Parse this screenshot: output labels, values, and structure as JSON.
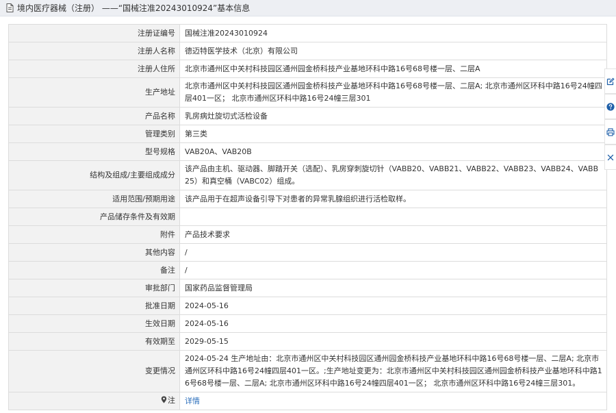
{
  "header": {
    "icon": "document-icon",
    "title": "境内医疗器械（注册） ——“国械注准20243010924”基本信息"
  },
  "rows": [
    {
      "label": "注册证编号",
      "value": "国械注准20243010924"
    },
    {
      "label": "注册人名称",
      "value": "德迈特医学技术（北京）有限公司"
    },
    {
      "label": "注册人住所",
      "value": "北京市通州区中关村科技园区通州园金桥科技产业基地环科中路16号68号楼一层、二层A"
    },
    {
      "label": "生产地址",
      "value": "北京市通州区中关村科技园区通州园金桥科技产业基地环科中路16号68号楼一层、二层A; 北京市通州区环科中路16号24幢四层401一区； 北京市通州区环科中路16号24幢三层301"
    },
    {
      "label": "产品名称",
      "value": "乳房病灶旋切式活检设备"
    },
    {
      "label": "管理类别",
      "value": "第三类"
    },
    {
      "label": "型号规格",
      "value": "VAB20A、VAB20B"
    },
    {
      "label": "结构及组成/主要组成成分",
      "value": "该产品由主机、驱动器、脚踏开关（选配）、乳房穿刺旋切针（VABB20、VABB21、VABB22、VABB23、VABB24、VABB25）和真空桶（VABC02）组成。"
    },
    {
      "label": "适用范围/预期用途",
      "value": "该产品用于在超声设备引导下对患者的异常乳腺组织进行活检取样。"
    },
    {
      "label": "产品储存条件及有效期",
      "value": ""
    },
    {
      "label": "附件",
      "value": "产品技术要求"
    },
    {
      "label": "其他内容",
      "value": "/"
    },
    {
      "label": "备注",
      "value": "/"
    },
    {
      "label": "审批部门",
      "value": "国家药品监督管理局"
    },
    {
      "label": "批准日期",
      "value": "2024-05-16"
    },
    {
      "label": "生效日期",
      "value": "2024-05-16"
    },
    {
      "label": "有效期至",
      "value": "2029-05-15"
    },
    {
      "label": "变更情况",
      "value": "2024-05-24 生产地址由：北京市通州区中关村科技园区通州园金桥科技产业基地环科中路16号68号楼一层、二层A; 北京市通州区环科中路16号24幢四层401一区。;生产地址变更为：北京市通州区中关村科技园区通州园金桥科技产业基地环科中路16号68号楼一层、二层A; 北京市通州区环科中路16号24幢四层401一区； 北京市通州区环科中路16号24幢三层301。"
    }
  ],
  "note_row": {
    "label": "注",
    "marker_icon": "pin-icon",
    "link_text": "详情"
  },
  "side_tools": [
    "edit-icon",
    "help-icon",
    "print-icon",
    "close-icon"
  ],
  "colors": {
    "link": "#2a6ebb",
    "tool_icon": "#1f5fa8",
    "label_bg": "#f2f2f2",
    "header_bg": "#edeff3"
  }
}
